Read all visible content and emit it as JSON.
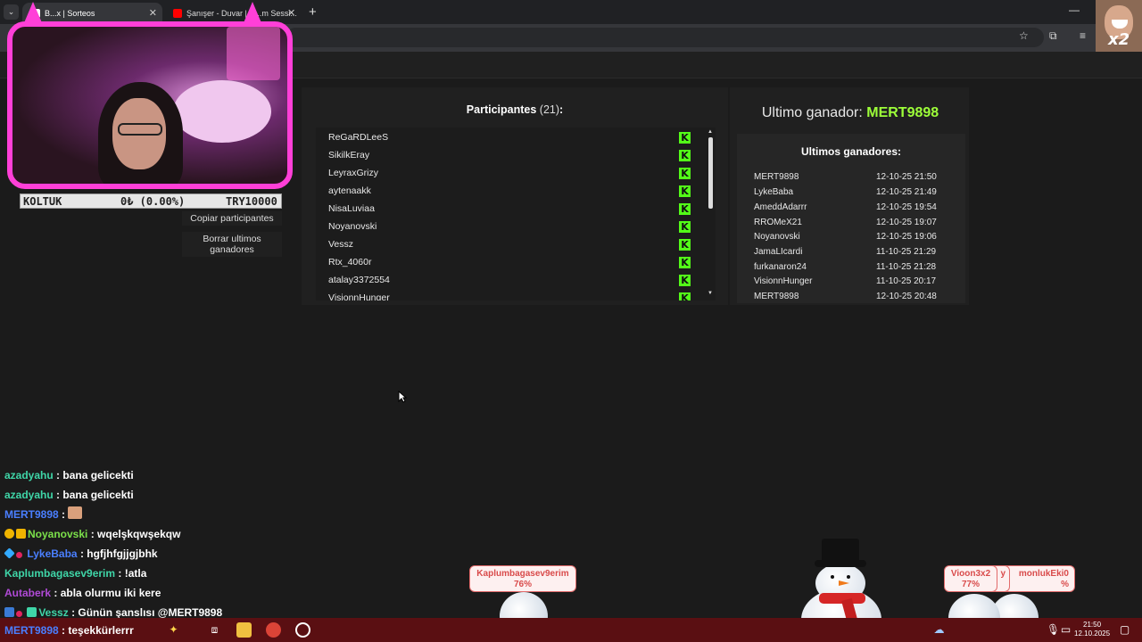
{
  "browser": {
    "tabs": [
      {
        "label": "B...x | Sorteos",
        "active": true
      },
      {
        "label": "Şanışer - Duvar | H...m Sessi...",
        "active": false
      }
    ],
    "new_tab": "+",
    "minimize": "—"
  },
  "overlay": {
    "ticker": {
      "left": "KOLTUK",
      "mid": "0₺ (0.00%)",
      "right": "TRY10000"
    },
    "badge_x2": "x2"
  },
  "actions": {
    "copy_participants": "Copiar participantes",
    "clear_winners": "Borrar ultimos ganadores"
  },
  "participants": {
    "title": "Participantes",
    "count": "(21)",
    "colon": ":",
    "platform_icon": "kick-icon",
    "kick_glyph": "K",
    "items": [
      "ReGaRDLeeS",
      "SikilkEray",
      "LeyraxGrizy",
      "aytenaakk",
      "NisaLuviaa",
      "Noyanovski",
      "Vessz",
      "Rtx_4060r",
      "atalay3372554",
      "VisionnHunger"
    ]
  },
  "winners": {
    "last_label": "Ultimo ganador:",
    "last_name": "MERT9898",
    "list_title": "Ultimos ganadores:",
    "items": [
      {
        "name": "MERT9898",
        "date": "12-10-25 21:50"
      },
      {
        "name": "LykeBaba",
        "date": "12-10-25 21:49"
      },
      {
        "name": "AmeddAdarrr",
        "date": "12-10-25 19:54"
      },
      {
        "name": "RROMeX21",
        "date": "12-10-25 19:07"
      },
      {
        "name": "Noyanovski",
        "date": "12-10-25 19:06"
      },
      {
        "name": "JamaLIcardi",
        "date": "11-10-25 21:29"
      },
      {
        "name": "furkanaron24",
        "date": "11-10-25 21:28"
      },
      {
        "name": "VisionnHunger",
        "date": "11-10-25 20:17"
      },
      {
        "name": "MERT9898",
        "date": "12-10-25 20:48"
      }
    ]
  },
  "chat": [
    {
      "user": "azadyahu",
      "msg": ": bana gelicekti",
      "color": "#3fd6a8"
    },
    {
      "user": "azadyahu",
      "msg": ": bana gelicekti",
      "color": "#3fd6a8"
    },
    {
      "user": "MERT9898",
      "msg": ":",
      "color": "#4a7fff"
    },
    {
      "user": "Noyanovski",
      "msg": ": wqelşkqwşekqw",
      "color": "#7be04a"
    },
    {
      "user": "LykeBaba",
      "msg": ": hgfjhfgjjgjbhk",
      "color": "#4a7fff"
    },
    {
      "user": "Kaplumbagasev9erim",
      "msg": ": !atla",
      "color": "#3fd6a8"
    },
    {
      "user": "Autaberk",
      "msg": ": abla olurmu iki kere",
      "color": "#b04ad6"
    },
    {
      "user": "Vessz",
      "msg": ": Günün şanslısı @MERT9898",
      "color": "#3fd6a8"
    },
    {
      "user": "MERT9898",
      "msg": ": teşekkürlerrr",
      "color": "#4a7fff"
    }
  ],
  "game": {
    "tags": [
      {
        "name": "Kaplumbagasev9erim",
        "pct": "76%"
      },
      {
        "name": "Vioon3x2",
        "pct": "77%"
      },
      {
        "name": "y",
        "pct": ""
      },
      {
        "name": "monlukEki0",
        "pct": "%"
      }
    ]
  },
  "taskbar": {
    "time": "21:50",
    "date": "12.10.2025"
  }
}
